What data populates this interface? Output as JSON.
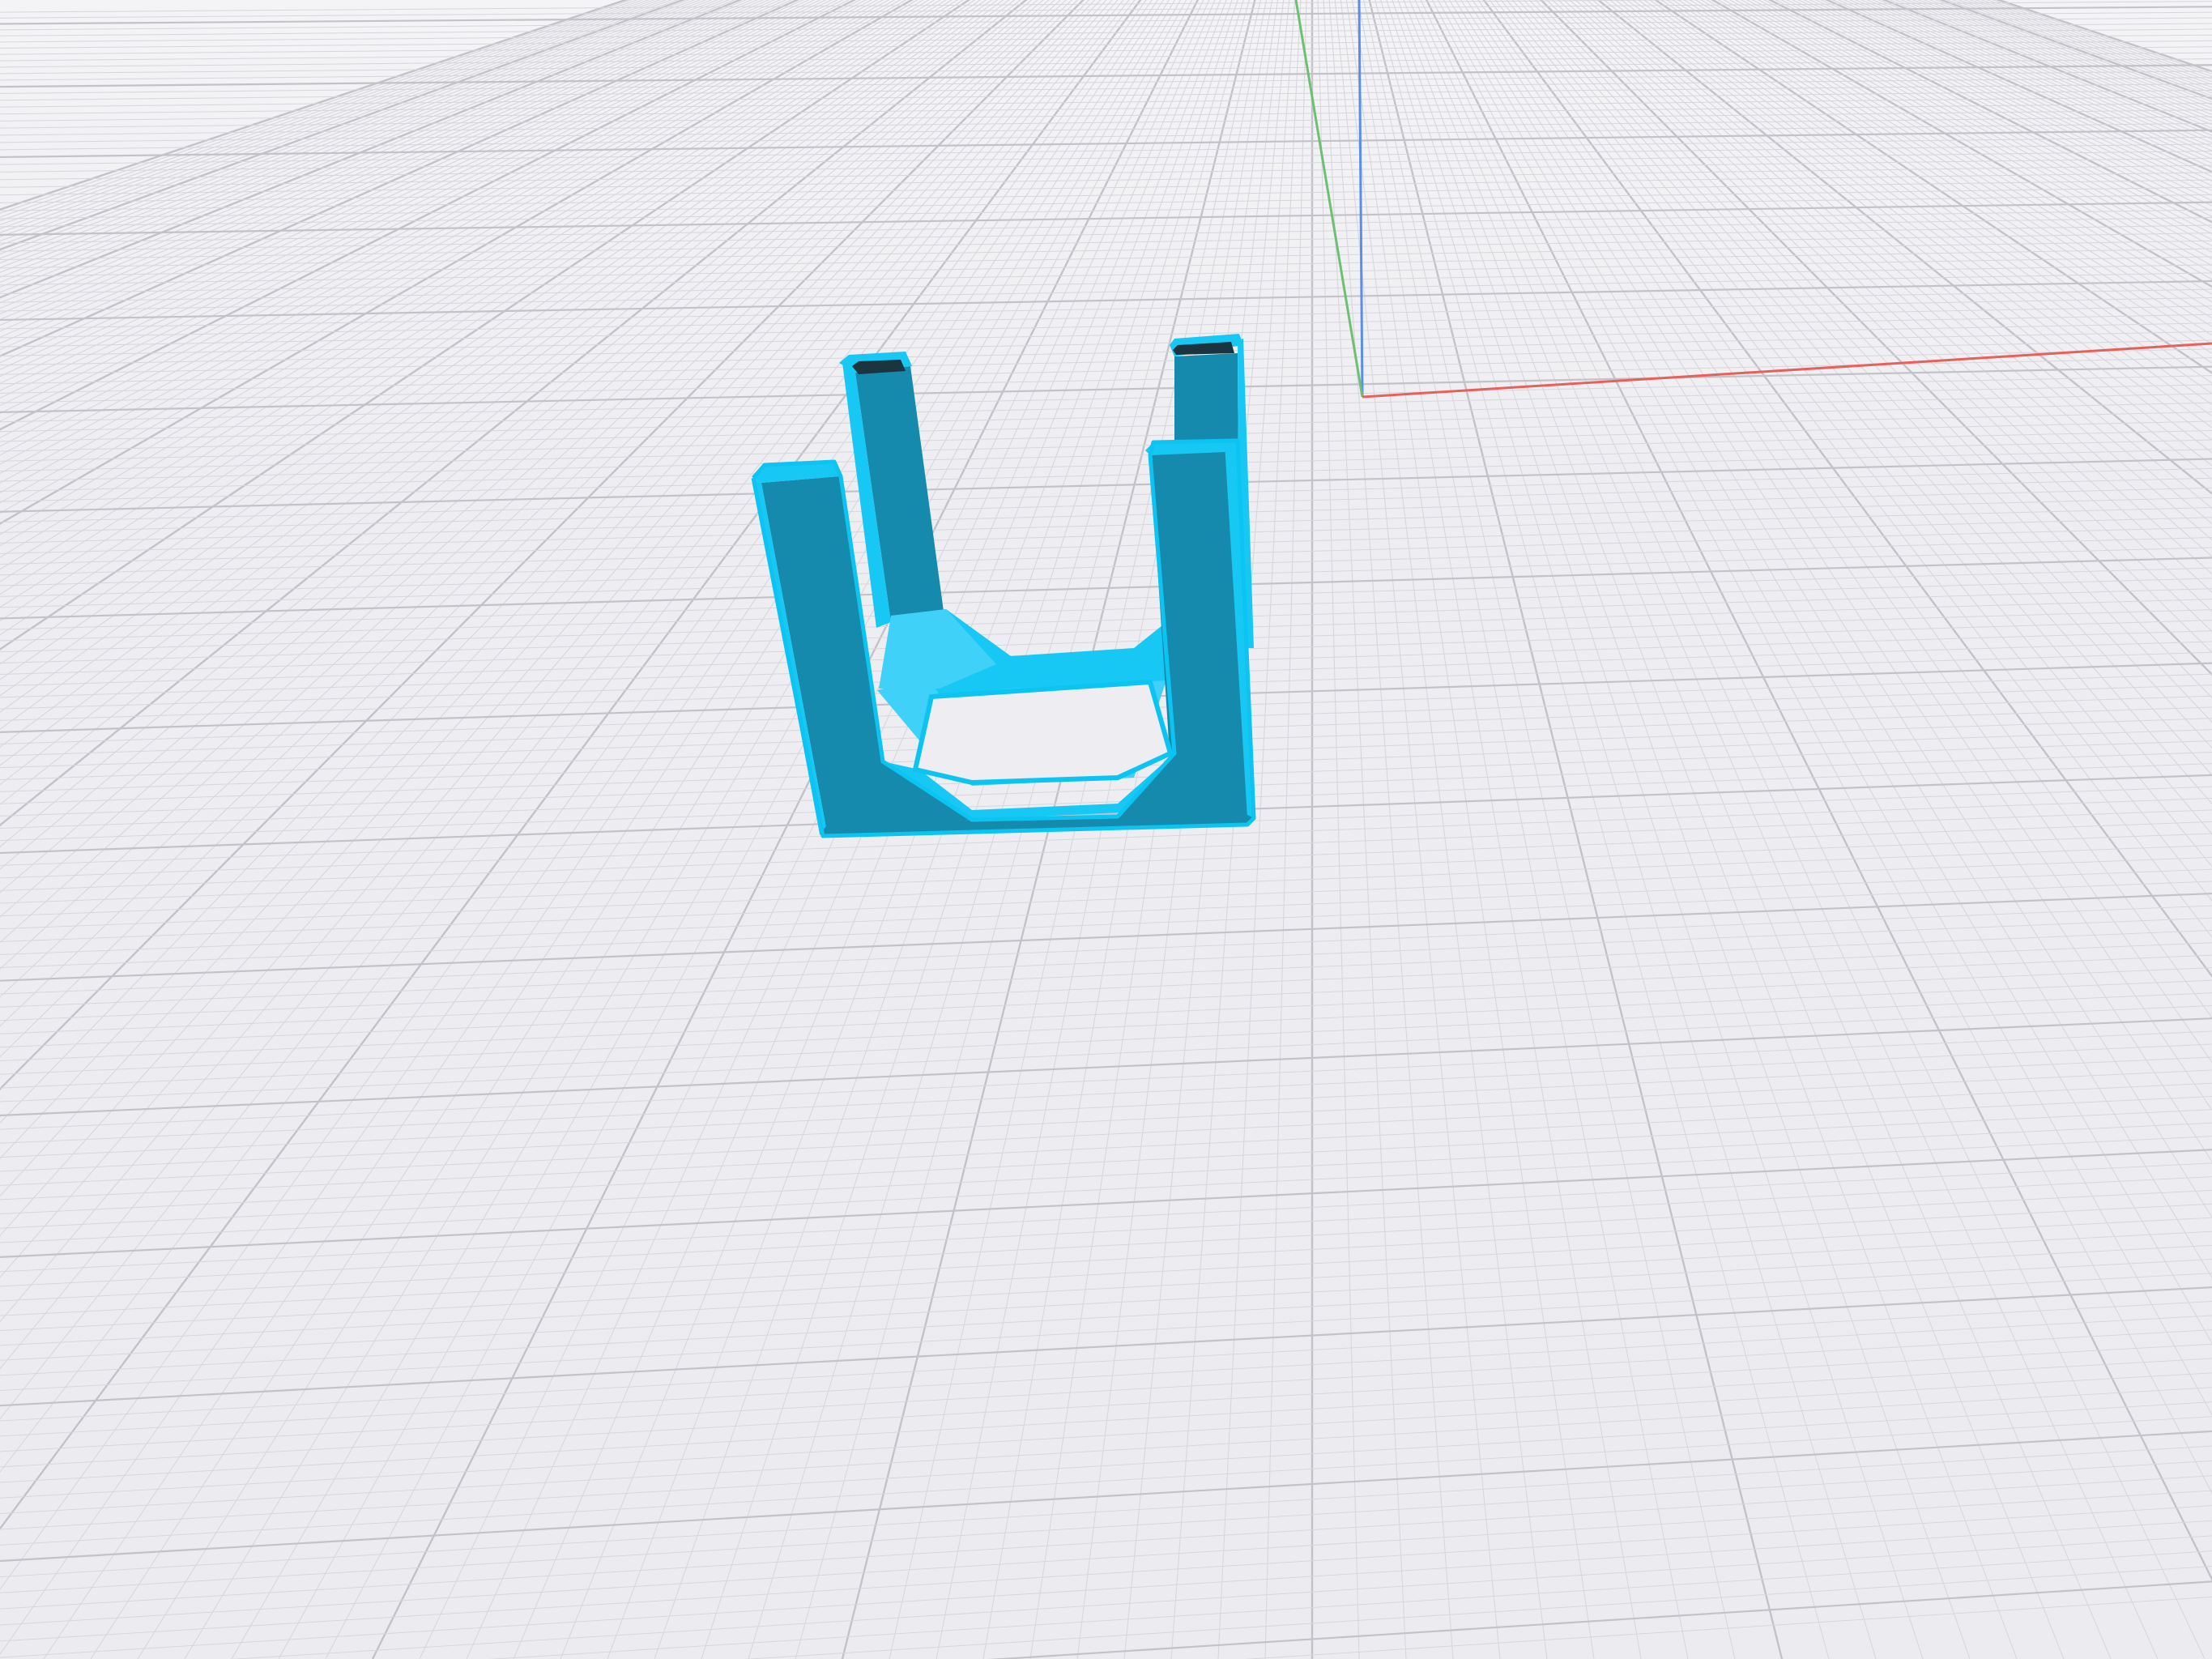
{
  "viewport": {
    "background_color": "#eeeef2",
    "grid_minor_color": "#d6d6dc",
    "grid_major_color": "#c2c2c8"
  },
  "axes": {
    "x_color": "#e8605a",
    "y_color": "#6cc070",
    "z_color": "#5a8ee8"
  },
  "model": {
    "shape": "u-shaped-frame",
    "face_color_light": "#17c8f5",
    "face_color_dark": "#168aad",
    "face_color_mid": "#3fd1f7",
    "edge_color": "#0bc4f2",
    "slot_color": "#1a3440"
  }
}
